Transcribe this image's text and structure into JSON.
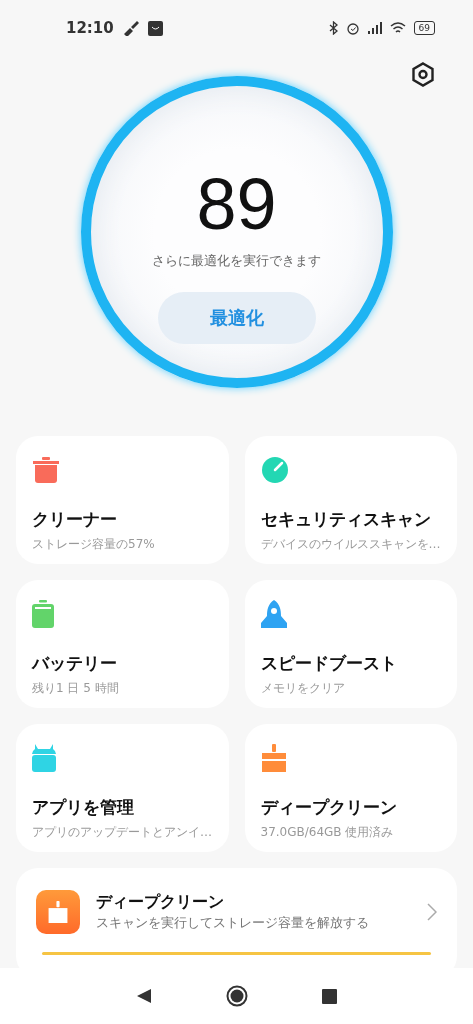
{
  "status_bar": {
    "time": "12:10",
    "battery": "69"
  },
  "score": {
    "value": "89",
    "message": "さらに最適化を実行できます",
    "button": "最適化"
  },
  "tiles": [
    {
      "kind": "trash",
      "title": "クリーナー",
      "subtitle": "ストレージ容量の57%"
    },
    {
      "kind": "shield",
      "title": "セキュリティスキャン",
      "subtitle": "デバイスのウイルススキャンを…"
    },
    {
      "kind": "battery",
      "title": "バッテリー",
      "subtitle": "残り1 日 5 時間"
    },
    {
      "kind": "rocket",
      "title": "スピードブースト",
      "subtitle": "メモリをクリア"
    },
    {
      "kind": "apps",
      "title": "アプリを管理",
      "subtitle": "アプリのアップデートとアンイ…"
    },
    {
      "kind": "broom",
      "title": "ディープクリーン",
      "subtitle": "37.0GB/64GB 使用済み"
    }
  ],
  "banner": {
    "title": "ディープクリーン",
    "subtitle": "スキャンを実行してストレージ容量を解放する"
  }
}
